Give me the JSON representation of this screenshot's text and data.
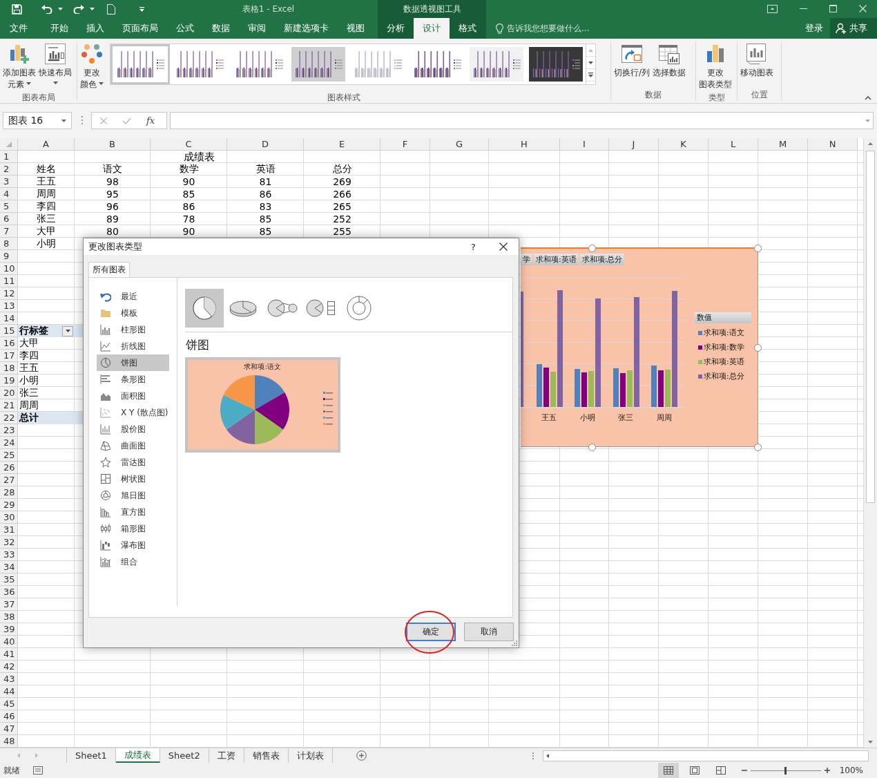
{
  "title_bar": {
    "title": "表格1 - Excel",
    "context_title": "数据透视图工具"
  },
  "ribbon_tabs": [
    {
      "label": "文件",
      "selected": false
    },
    {
      "label": "开始",
      "selected": false
    },
    {
      "label": "插入",
      "selected": false
    },
    {
      "label": "页面布局",
      "selected": false
    },
    {
      "label": "公式",
      "selected": false
    },
    {
      "label": "数据",
      "selected": false
    },
    {
      "label": "审阅",
      "selected": false
    },
    {
      "label": "新建选项卡",
      "selected": false
    },
    {
      "label": "视图",
      "selected": false
    }
  ],
  "context_tabs": [
    {
      "label": "分析",
      "selected": false
    },
    {
      "label": "设计",
      "selected": true
    },
    {
      "label": "格式",
      "selected": false
    }
  ],
  "tell_me": "告诉我您想要做什么...",
  "sign_in": "登录",
  "share": "共享",
  "ribbon_groups": [
    {
      "label": "图表布局",
      "buttons": [
        {
          "kind": "add_element",
          "lines": [
            "添加图表",
            "元素"
          ],
          "dropdown": true
        },
        {
          "kind": "quick_layout",
          "lines": [
            "快速布局"
          ],
          "dropdown": true
        }
      ]
    },
    {
      "label": "图表样式",
      "buttons": [
        {
          "kind": "colors",
          "lines": [
            "更改",
            "颜色"
          ],
          "dropdown": true
        }
      ],
      "gallery": [
        {
          "kind": "plain",
          "selected": true
        },
        {
          "kind": "labeled",
          "selected": false
        },
        {
          "kind": "dotted",
          "selected": false
        },
        {
          "kind": "shaded",
          "selected": false
        },
        {
          "kind": "light",
          "selected": false
        },
        {
          "kind": "bold",
          "selected": false
        },
        {
          "kind": "hatched",
          "selected": false
        },
        {
          "kind": "dark",
          "selected": false
        }
      ]
    },
    {
      "label": "数据",
      "buttons": [
        {
          "kind": "switch",
          "lines": [
            "切换行/列"
          ],
          "dropdown": false
        },
        {
          "kind": "select_data",
          "lines": [
            "选择数据"
          ],
          "dropdown": false
        }
      ]
    },
    {
      "label": "类型",
      "buttons": [
        {
          "kind": "change_type",
          "lines": [
            "更改",
            "图表类型"
          ],
          "dropdown": false
        }
      ]
    },
    {
      "label": "位置",
      "buttons": [
        {
          "kind": "move",
          "lines": [
            "移动图表"
          ],
          "dropdown": false
        }
      ]
    }
  ],
  "formula_bar": {
    "name_box": "图表 16",
    "function_label": "fx"
  },
  "sheet": {
    "columns": [
      "A",
      "B",
      "C",
      "D",
      "E",
      "F",
      "G",
      "H",
      "I",
      "J",
      "K",
      "L",
      "M",
      "N"
    ],
    "rows": [
      {
        "number": "1",
        "kind": "title",
        "cells": [
          "成绩表"
        ]
      },
      {
        "number": "2",
        "kind": "data",
        "cells": [
          "姓名",
          "语文",
          "数学",
          "英语",
          "总分"
        ]
      },
      {
        "number": "3",
        "kind": "data",
        "cells": [
          "王五",
          "98",
          "90",
          "81",
          "269"
        ]
      },
      {
        "number": "4",
        "kind": "data",
        "cells": [
          "周周",
          "95",
          "85",
          "86",
          "266"
        ]
      },
      {
        "number": "5",
        "kind": "data",
        "cells": [
          "李四",
          "96",
          "86",
          "83",
          "265"
        ]
      },
      {
        "number": "6",
        "kind": "data",
        "cells": [
          "张三",
          "89",
          "78",
          "85",
          "252"
        ]
      },
      {
        "number": "7",
        "kind": "data",
        "cells": [
          "大甲",
          "80",
          "90",
          "85",
          "255"
        ]
      },
      {
        "number": "8",
        "kind": "data",
        "cells": [
          "小明"
        ]
      },
      {
        "number": "9"
      },
      {
        "number": "10"
      },
      {
        "number": "11"
      },
      {
        "number": "12"
      },
      {
        "number": "13"
      },
      {
        "number": "14"
      },
      {
        "number": "15",
        "kind": "pivot_header",
        "cells": [
          "行标签"
        ],
        "filter": true
      },
      {
        "number": "16",
        "kind": "pivot",
        "cells": [
          "大甲"
        ]
      },
      {
        "number": "17",
        "kind": "pivot",
        "cells": [
          "李四"
        ]
      },
      {
        "number": "18",
        "kind": "pivot",
        "cells": [
          "王五"
        ]
      },
      {
        "number": "19",
        "kind": "pivot",
        "cells": [
          "小明"
        ]
      },
      {
        "number": "20",
        "kind": "pivot",
        "cells": [
          "张三"
        ]
      },
      {
        "number": "21",
        "kind": "pivot",
        "cells": [
          "周周"
        ]
      },
      {
        "number": "22",
        "kind": "pivot_total",
        "cells": [
          "总计"
        ]
      },
      {
        "number": "23"
      },
      {
        "number": "24"
      },
      {
        "number": "25"
      },
      {
        "number": "26"
      },
      {
        "number": "27"
      },
      {
        "number": "28"
      },
      {
        "number": "29"
      },
      {
        "number": "30"
      },
      {
        "number": "31"
      },
      {
        "number": "32"
      },
      {
        "number": "33"
      },
      {
        "number": "34"
      },
      {
        "number": "35"
      },
      {
        "number": "36"
      },
      {
        "number": "37"
      },
      {
        "number": "38"
      },
      {
        "number": "39"
      },
      {
        "number": "40"
      },
      {
        "number": "41"
      },
      {
        "number": "42"
      },
      {
        "number": "43"
      },
      {
        "number": "44"
      },
      {
        "number": "45"
      },
      {
        "number": "46"
      },
      {
        "number": "47"
      },
      {
        "number": "48"
      }
    ]
  },
  "chart": {
    "field_buttons": [
      "学",
      "求和项:英语",
      "求和项:总分"
    ],
    "categories": [
      "王五",
      "小明",
      "张三",
      "周周"
    ],
    "legend_title": "数值",
    "legend": [
      {
        "label": "求和项:语文",
        "color": "#4f81bd"
      },
      {
        "label": "求和项:数学",
        "color": "#800080"
      },
      {
        "label": "求和项:英语",
        "color": "#9bbb59"
      },
      {
        "label": "求和项:总分",
        "color": "#8064a2"
      }
    ]
  },
  "dialog": {
    "title": "更改图表类型",
    "help": "?",
    "tabs": [
      {
        "label": "所有图表",
        "selected": true
      }
    ],
    "chart_types": [
      {
        "kind": "recent",
        "label": "最近",
        "selected": false
      },
      {
        "kind": "template",
        "label": "模板",
        "selected": false
      },
      {
        "kind": "column",
        "label": "柱形图",
        "selected": false
      },
      {
        "kind": "line",
        "label": "折线图",
        "selected": false
      },
      {
        "kind": "pie",
        "label": "饼图",
        "selected": true
      },
      {
        "kind": "bar",
        "label": "条形图",
        "selected": false
      },
      {
        "kind": "area",
        "label": "面积图",
        "selected": false
      },
      {
        "kind": "scatter",
        "label": "X Y (散点图)",
        "selected": false
      },
      {
        "kind": "stock",
        "label": "股价图",
        "selected": false
      },
      {
        "kind": "surface",
        "label": "曲面图",
        "selected": false
      },
      {
        "kind": "radar",
        "label": "雷达图",
        "selected": false
      },
      {
        "kind": "treemap",
        "label": "树状图",
        "selected": false
      },
      {
        "kind": "sunburst",
        "label": "旭日图",
        "selected": false
      },
      {
        "kind": "histogram",
        "label": "直方图",
        "selected": false
      },
      {
        "kind": "box",
        "label": "箱形图",
        "selected": false
      },
      {
        "kind": "waterfall",
        "label": "瀑布图",
        "selected": false
      },
      {
        "kind": "combo",
        "label": "组合",
        "selected": false
      }
    ],
    "subtypes": [
      {
        "kind": "pie",
        "selected": true
      },
      {
        "kind": "pie3d",
        "selected": false
      },
      {
        "kind": "pie_of_pie",
        "selected": false
      },
      {
        "kind": "bar_of_pie",
        "selected": false
      },
      {
        "kind": "doughnut",
        "selected": false
      }
    ],
    "heading": "饼图",
    "preview": {
      "title": "求和项:语文"
    },
    "buttons": [
      {
        "label": "确定",
        "default": true,
        "annotated": true
      },
      {
        "label": "取消",
        "default": false,
        "annotated": false
      }
    ]
  },
  "sheet_tabs": [
    {
      "label": "Sheet1",
      "selected": false
    },
    {
      "label": "成绩表",
      "selected": true
    },
    {
      "label": "Sheet2",
      "selected": false
    },
    {
      "label": "工资",
      "selected": false
    },
    {
      "label": "销售表",
      "selected": false
    },
    {
      "label": "计划表",
      "selected": false
    }
  ],
  "status_bar": {
    "text": "就绪",
    "views": [
      {
        "kind": "normal",
        "selected": true
      },
      {
        "kind": "page_layout",
        "selected": false
      },
      {
        "kind": "page_break",
        "selected": false
      }
    ],
    "zoom": {
      "level": 0.5,
      "text": "100%"
    }
  }
}
